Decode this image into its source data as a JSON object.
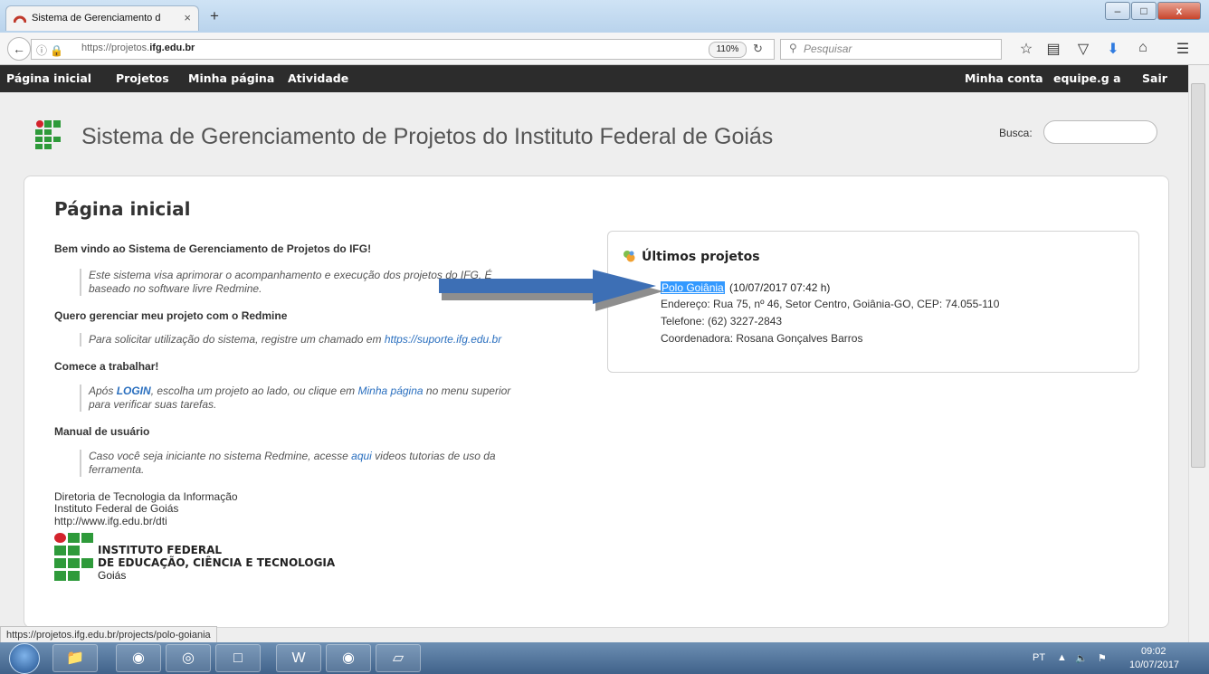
{
  "browser": {
    "tab_title": "Sistema de Gerenciamento d",
    "tab_close": "×",
    "new_tab": "+",
    "url_prefix": "https://projetos.",
    "url_domain": "ifg.edu.br",
    "zoom": "110%",
    "search_placeholder": "Pesquisar",
    "window_buttons": [
      "–",
      "□",
      "x"
    ]
  },
  "nav": {
    "left": [
      "Página inicial",
      "Projetos",
      "Minha página",
      "Atividade"
    ],
    "right": [
      "Minha conta",
      "equipe.g a",
      "Sair"
    ]
  },
  "header": {
    "title": "Sistema de Gerenciamento de Projetos do Instituto Federal de Goiás",
    "search_label": "Busca:"
  },
  "main": {
    "page_title": "Página inicial",
    "welcome_heading": "Bem vindo ao Sistema de Gerenciamento de Projetos do IFG!",
    "welcome_text_1": "Este sistema visa aprimorar o acompanhamento e execução dos projetos do IFG. É",
    "welcome_text_2": "baseado no software livre Redmine.",
    "manage_heading": "Quero gerenciar meu projeto com o Redmine",
    "manage_text": "Para solicitar utilização do sistema, registre um chamado em ",
    "manage_link": "https://suporte.ifg.edu.br",
    "start_heading": "Comece a trabalhar!",
    "start_text_1a": "Após ",
    "start_login": "LOGIN",
    "start_text_1b": ", escolha um projeto ao lado, ou clique em ",
    "start_link": "Minha página",
    "start_text_1c": " no menu superior",
    "start_text_2": "para verificar suas tarefas.",
    "manual_heading": "Manual de usuário",
    "manual_text_1a": "Caso você seja iniciante no sistema Redmine, acesse ",
    "manual_link": "aqui",
    "manual_text_1b": " videos tutorias de uso da",
    "manual_text_2": "ferramenta.",
    "footer_1": "Diretoria de Tecnologia da Informação",
    "footer_2": "Instituto Federal de Goiás",
    "footer_link": "http://www.ifg.edu.br/dti",
    "org_line1": "INSTITUTO FEDERAL",
    "org_line2": "DE EDUCAÇÃO, CIÊNCIA E TECNOLOGIA",
    "org_line3": "Goiás"
  },
  "projects": {
    "title": "Últimos projetos",
    "item_name": "Polo Goiânia",
    "item_date": "(10/07/2017 07:42 h)",
    "address": "Endereço: Rua 75, nº 46, Setor Centro, Goiânia-GO, CEP: 74.055-110",
    "phone": "Telefone: (62) 3227-2843",
    "coordinator": "Coordenadora: Rosana Gonçalves Barros"
  },
  "status_url": "https://projetos.ifg.edu.br/projects/polo-goiania",
  "taskbar": {
    "language": "PT",
    "time": "09:02",
    "date": "10/07/2017"
  },
  "colors": {
    "ifg_green": "#2e9a3a",
    "ifg_red": "#d3232c",
    "link": "#2a6fbf",
    "nav_bg": "#2c2c2c",
    "arrow": "#3d6fb5"
  }
}
